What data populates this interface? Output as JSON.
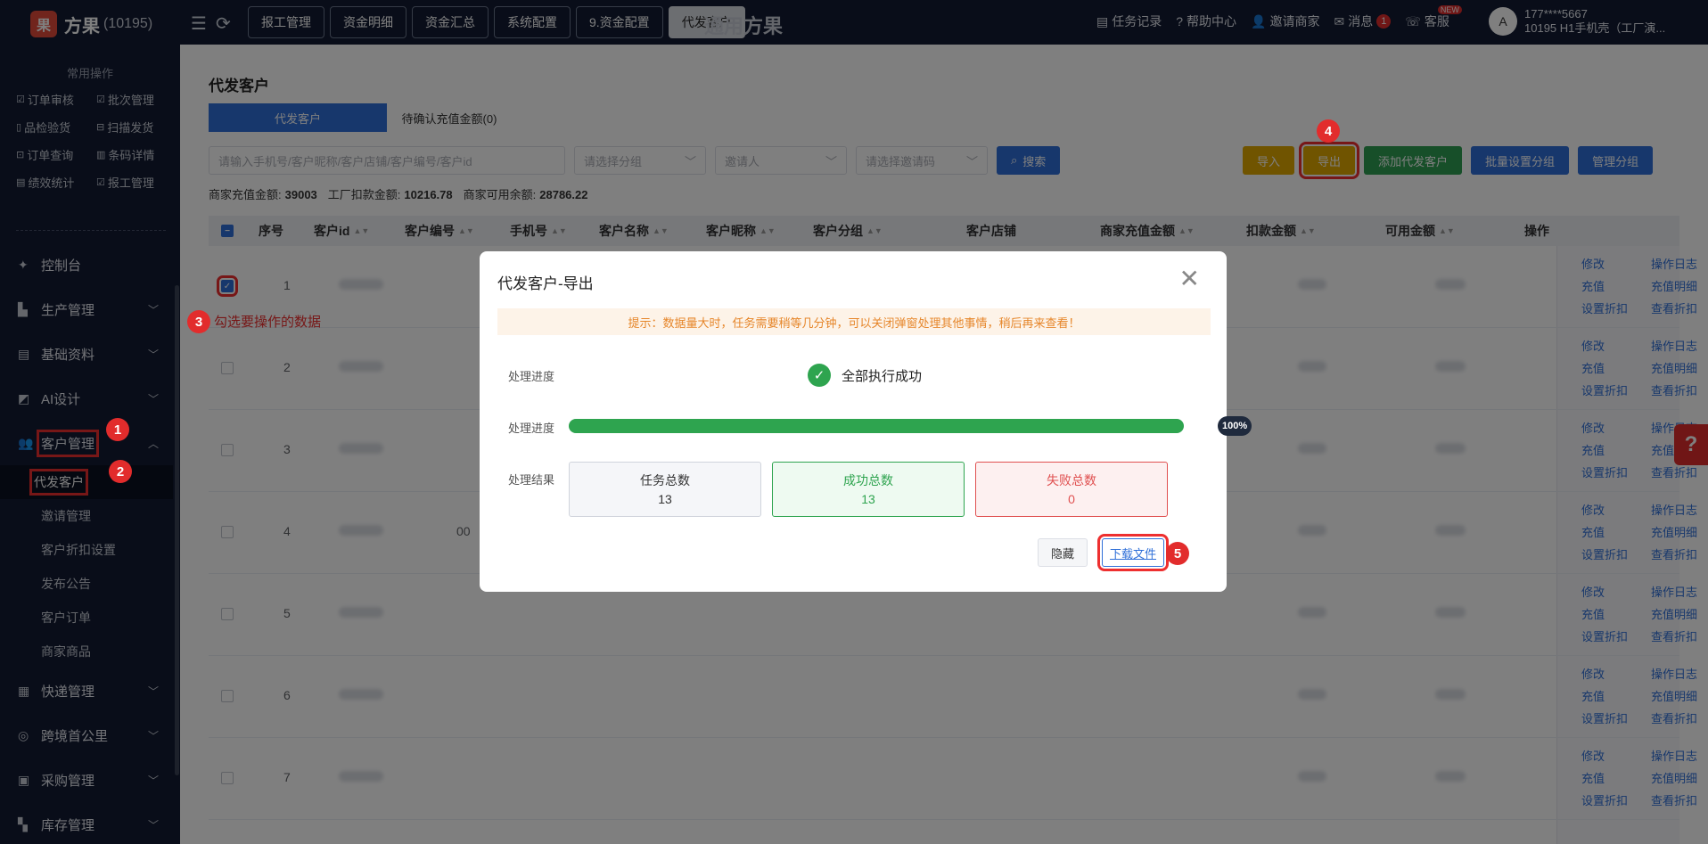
{
  "app": {
    "logo_char": "果",
    "name": "方果",
    "code": "(10195)",
    "bg_title": "通用方果"
  },
  "top_tabs": [
    {
      "label": "报工管理"
    },
    {
      "label": "资金明细"
    },
    {
      "label": "资金汇总"
    },
    {
      "label": "系统配置"
    },
    {
      "label": "9.资金配置"
    },
    {
      "label": "代发客户"
    }
  ],
  "top_links": {
    "tasks": "任务记录",
    "help": "帮助中心",
    "invite": "邀请商家",
    "msg": "消息",
    "msg_count": "1",
    "service": "客服",
    "new_tag": "NEW"
  },
  "user": {
    "phone": "177****5667",
    "org": "10195 H1手机壳（工厂演..."
  },
  "sidebar": {
    "common_title": "常用操作",
    "quick": [
      "订单审核",
      "批次管理",
      "品检验货",
      "扫描发货",
      "订单查询",
      "条码详情",
      "绩效统计",
      "报工管理"
    ],
    "menu": [
      {
        "label": "控制台"
      },
      {
        "label": "生产管理"
      },
      {
        "label": "基础资料"
      },
      {
        "label": "AI设计"
      },
      {
        "label": "客户管理"
      }
    ],
    "customer_sub": [
      "代发客户",
      "邀请管理",
      "客户折扣设置",
      "发布公告",
      "客户订单",
      "商家商品"
    ],
    "menu_after": [
      {
        "label": "快递管理"
      },
      {
        "label": "跨境首公里"
      },
      {
        "label": "采购管理"
      },
      {
        "label": "库存管理"
      }
    ]
  },
  "page": {
    "title": "代发客户",
    "tab_active": "代发客户",
    "tab_pending": "待确认充值金额(0)",
    "search_placeholder": "请输入手机号/客户昵称/客户店铺/客户编号/客户id",
    "group_placeholder": "请选择分组",
    "inviter_placeholder": "邀请人",
    "code_placeholder": "请选择邀请码",
    "search_btn": "搜索",
    "btn_import": "导入",
    "btn_export": "导出",
    "btn_add": "添加代发客户",
    "btn_batch_group": "批量设置分组",
    "btn_manage_group": "管理分组",
    "stats": {
      "recharge_label": "商家充值金额:",
      "recharge": "39003",
      "deduct_label": "工厂扣款金额:",
      "deduct": "10216.78",
      "avail_label": "商家可用余额:",
      "avail": "28786.22"
    }
  },
  "table": {
    "headers": [
      "序号",
      "客户id",
      "客户编号",
      "手机号",
      "客户名称",
      "客户昵称",
      "客户分组",
      "客户店铺",
      "商家充值金额",
      "扣款金额",
      "可用金额",
      "操作"
    ],
    "rows": [
      {
        "no": "1",
        "code": ""
      },
      {
        "no": "2",
        "code": ""
      },
      {
        "no": "3",
        "code": ""
      },
      {
        "no": "4",
        "code": "00"
      },
      {
        "no": "5",
        "code": ""
      },
      {
        "no": "6",
        "code": ""
      },
      {
        "no": "7",
        "code": ""
      }
    ],
    "ops": [
      "修改",
      "操作日志",
      "充值",
      "充值明细",
      "设置折扣",
      "查看折扣"
    ]
  },
  "annotations": {
    "step3_text": "勾选要操作的数据"
  },
  "modal": {
    "title": "代发客户-导出",
    "tip": "提示：数据量大时，任务需要稍等几分钟，可以关闭弹窗处理其他事情，稍后再来查看！",
    "progress_label": "处理进度",
    "status_text": "全部执行成功",
    "progress_label2": "处理进度",
    "progress": 100,
    "progress_text": "100%",
    "result_label": "处理结果",
    "total_label": "任务总数",
    "total": "13",
    "success_label": "成功总数",
    "success": "13",
    "fail_label": "失败总数",
    "fail": "0",
    "btn_hide": "隐藏",
    "btn_download": "下载文件"
  },
  "colors": {
    "accent": "#2f6fd8",
    "success": "#2ea44f",
    "danger": "#e05050",
    "highlight": "#ee2f2f"
  }
}
